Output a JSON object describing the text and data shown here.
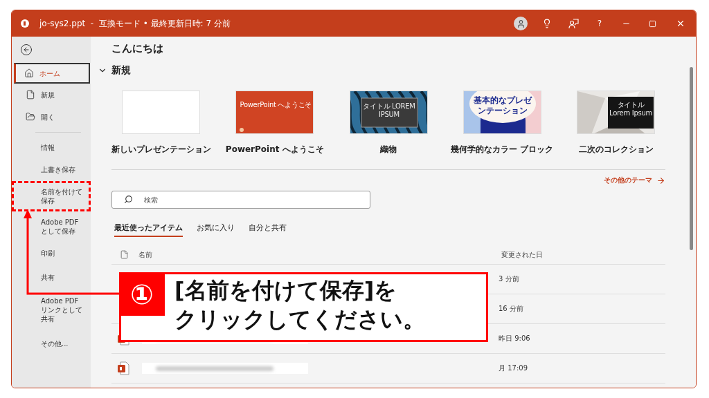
{
  "window": {
    "title": "jo-sys2.ppt  -  互換モード • 最終更新日時: 7 分前",
    "help": "?"
  },
  "sidebar": {
    "items": [
      {
        "label": "ホーム",
        "kind": "home",
        "selected": true
      },
      {
        "label": "新規",
        "kind": "file",
        "selected": false
      },
      {
        "label": "開く",
        "kind": "folder",
        "selected": false
      },
      {
        "label": "情報",
        "kind": "divider-before",
        "selected": false
      },
      {
        "label": "上書き保存",
        "selected": false
      },
      {
        "label": "名前を付けて保存",
        "selected": false,
        "highlighted": true
      },
      {
        "label": "Adobe PDF として保存",
        "selected": false
      },
      {
        "label": "印刷",
        "selected": false
      },
      {
        "label": "共有",
        "selected": false
      },
      {
        "label": "Adobe PDF リンクとして共有",
        "selected": false
      },
      {
        "label": "その他...",
        "selected": false
      }
    ]
  },
  "greeting": "こんにちは",
  "new_section": {
    "title": "新規",
    "expanded": true,
    "templates": [
      {
        "name": "新しいプレゼンテーション",
        "kind": "blank"
      },
      {
        "name": "PowerPoint へようこそ",
        "kind": "welcome",
        "slide_text": "PowerPoint へようこそ"
      },
      {
        "name": "織物",
        "kind": "weave",
        "slide_text": "タイトル LOREM IPSUM"
      },
      {
        "name": "幾何学的なカラー ブロック",
        "kind": "blocks",
        "slide_text": "基本的なプレゼンテーション"
      },
      {
        "name": "二次のコレクション",
        "kind": "geo",
        "slide_text": "タイトル Lorem Ipsum"
      }
    ],
    "more_link": "その他のテーマ"
  },
  "search": {
    "placeholder": "検索"
  },
  "tabs": [
    {
      "label": "最近使ったアイテム",
      "selected": true
    },
    {
      "label": "お気に入り",
      "selected": false
    },
    {
      "label": "自分と共有",
      "selected": false
    }
  ],
  "table": {
    "columns": [
      "名前",
      "変更された日"
    ],
    "rows": [
      {
        "modified": "3 分前",
        "covered": true
      },
      {
        "modified": "16 分前",
        "covered": true
      },
      {
        "modified": "昨日 9:06",
        "covered": false
      },
      {
        "modified": "月 17:09",
        "covered": false
      }
    ]
  },
  "callout": {
    "number": "①",
    "lines": [
      "[名前を付けて保存]を",
      "クリックしてください。"
    ]
  }
}
